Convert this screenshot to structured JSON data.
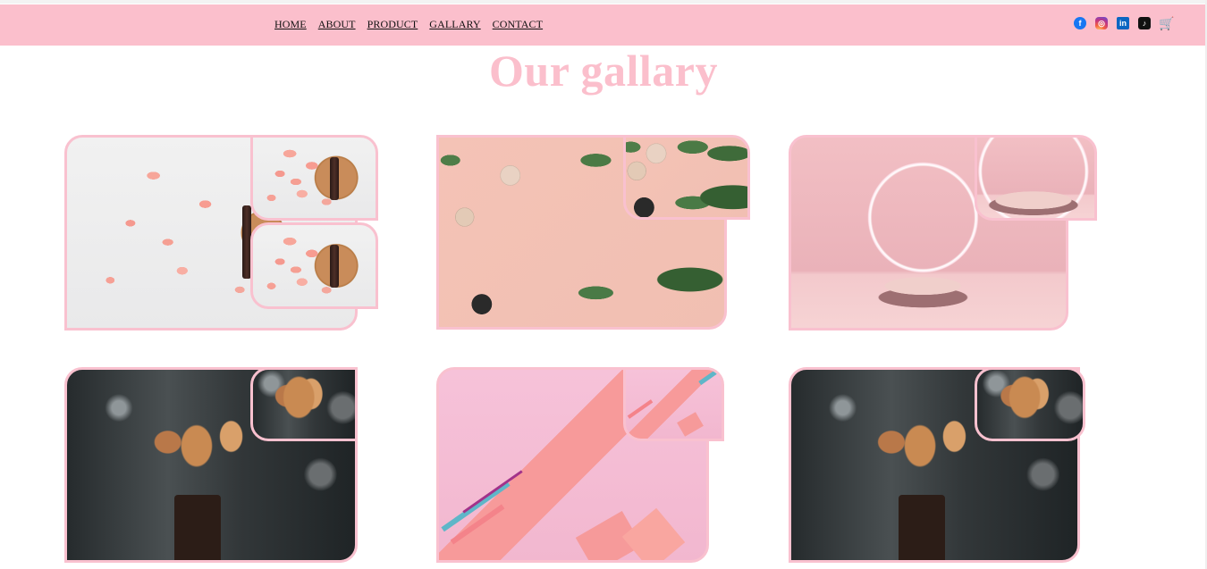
{
  "nav": {
    "links": [
      "HOME",
      "ABOUT",
      "PRODUCT",
      "GALLARY",
      "CONTACT"
    ],
    "icons": [
      "facebook-icon",
      "instagram-icon",
      "linkedin-icon",
      "tiktok-icon",
      "cart-icon"
    ]
  },
  "page": {
    "title": "Our gallary"
  },
  "colors": {
    "accent": "#fbbfcc",
    "border": "#f9c1cf",
    "background": "#ffffff"
  },
  "gallery": {
    "items": [
      {
        "image": "rose-petals-serum",
        "thumbs": [
          "rose-petals-serum",
          "rose-petals-serum"
        ]
      },
      {
        "image": "makeup-palm-leaves",
        "thumbs": [
          "makeup-palm-leaves"
        ]
      },
      {
        "image": "pink-podium-ring-light",
        "thumbs": [
          "pink-podium-ring-light"
        ]
      },
      {
        "image": "makeup-brushes",
        "thumbs": [
          "makeup-brushes"
        ]
      },
      {
        "image": "pink-geometric",
        "thumbs": [
          "pink-geometric"
        ]
      },
      {
        "image": "makeup-brushes",
        "thumbs": [
          "makeup-brushes"
        ]
      }
    ]
  }
}
